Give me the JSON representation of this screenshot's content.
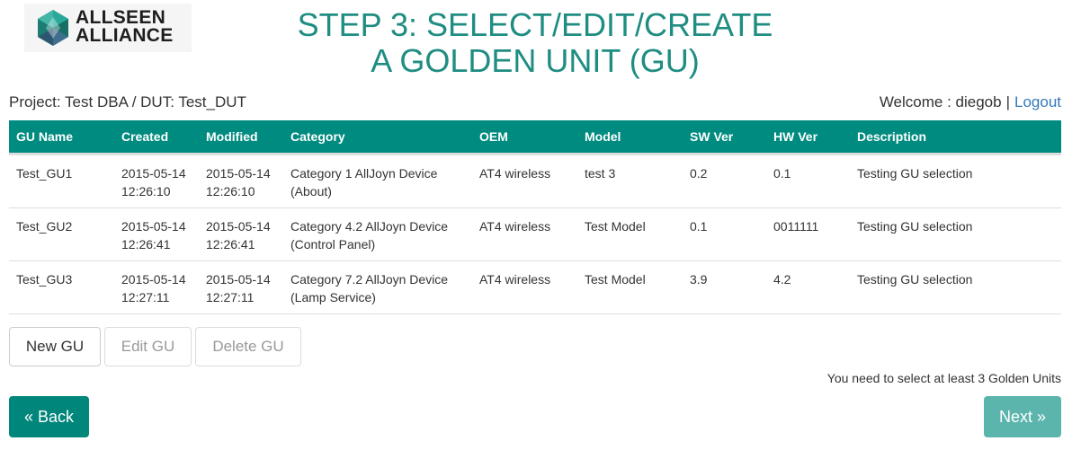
{
  "logo": {
    "line1": "ALLSEEN",
    "line2": "ALLIANCE"
  },
  "title": {
    "line1": "STEP 3: SELECT/EDIT/CREATE",
    "line2": "A GOLDEN UNIT (GU)"
  },
  "project_line": "Project: Test DBA / DUT: Test_DUT",
  "welcome": {
    "text": "Welcome : diegob",
    "separator": "|",
    "logout": "Logout"
  },
  "table": {
    "headers": [
      "GU Name",
      "Created",
      "Modified",
      "Category",
      "OEM",
      "Model",
      "SW Ver",
      "HW Ver",
      "Description"
    ],
    "rows": [
      {
        "name": "Test_GU1",
        "created_date": "2015-05-14",
        "created_time": "12:26:10",
        "modified_date": "2015-05-14",
        "modified_time": "12:26:10",
        "category_line1": "Category 1 AllJoyn Device",
        "category_line2": "(About)",
        "oem": "AT4 wireless",
        "model": "test 3",
        "sw_ver": "0.2",
        "hw_ver": "0.1",
        "description": "Testing GU selection"
      },
      {
        "name": "Test_GU2",
        "created_date": "2015-05-14",
        "created_time": "12:26:41",
        "modified_date": "2015-05-14",
        "modified_time": "12:26:41",
        "category_line1": "Category 4.2 AllJoyn Device",
        "category_line2": "(Control Panel)",
        "oem": "AT4 wireless",
        "model": "Test Model",
        "sw_ver": "0.1",
        "hw_ver": "0011111",
        "description": "Testing GU selection"
      },
      {
        "name": "Test_GU3",
        "created_date": "2015-05-14",
        "created_time": "12:27:11",
        "modified_date": "2015-05-14",
        "modified_time": "12:27:11",
        "category_line1": "Category 7.2 AllJoyn Device",
        "category_line2": "(Lamp Service)",
        "oem": "AT4 wireless",
        "model": "Test Model",
        "sw_ver": "3.9",
        "hw_ver": "4.2",
        "description": "Testing GU selection"
      }
    ]
  },
  "actions": {
    "new": "New GU",
    "edit": "Edit GU",
    "delete": "Delete GU"
  },
  "hint": "You need to select at least 3 Golden Units",
  "nav": {
    "back": "« Back",
    "next": "Next »"
  },
  "colors": {
    "brand_teal": "#008b80",
    "title_teal": "#1f8d82",
    "link_blue": "#337ab7",
    "next_disabled": "#5bb5ad"
  }
}
